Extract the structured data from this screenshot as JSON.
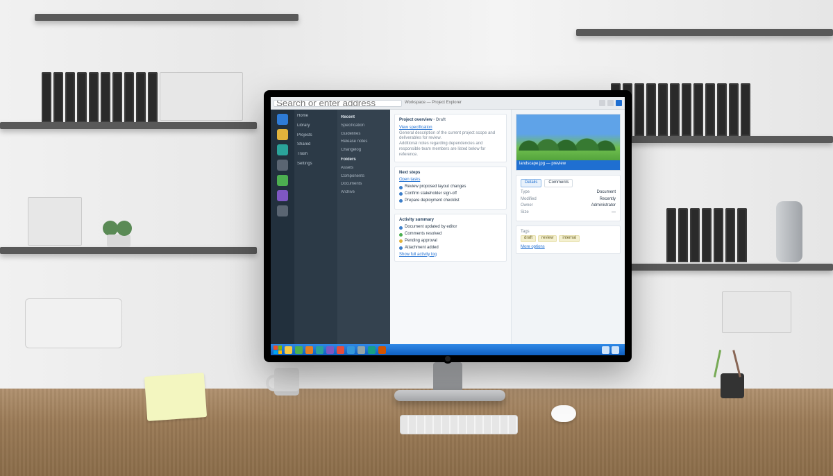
{
  "scene": {
    "description": "Photograph of a modern office desk with a widescreen monitor showing a split-pane desktop application, surrounded by shelves with binders, a plant, a mug, keyboard, mouse, sticky notes and a pencil holder."
  },
  "colors": {
    "accent": "#1f6fd1",
    "sidebar_dark": "#22303d",
    "sidebar_mid": "#2c3a47",
    "taskbar": "#1c72d6"
  },
  "titlebar": {
    "address_placeholder": "Search or enter address",
    "title": "Workspace — Project Explorer"
  },
  "sidebar_icons": [
    {
      "name": "home-icon",
      "color": "c-blue"
    },
    {
      "name": "folder-icon",
      "color": "c-yel"
    },
    {
      "name": "mail-icon",
      "color": "c-teal"
    },
    {
      "name": "clipboard-icon",
      "color": "c-gray"
    },
    {
      "name": "database-icon",
      "color": "c-grn"
    },
    {
      "name": "extensions-icon",
      "color": "c-pur"
    },
    {
      "name": "settings-icon",
      "color": "c-gray"
    }
  ],
  "sidebar_labels": {
    "items": [
      "Home",
      "Library",
      "Projects",
      "Shared",
      "Trash",
      "Settings"
    ]
  },
  "list": {
    "groups": [
      {
        "heading": "Recent",
        "items": [
          "Specification",
          "Guidelines",
          "Release notes",
          "Changelog"
        ]
      },
      {
        "heading": "Folders",
        "items": [
          "Assets",
          "Components",
          "Documents",
          "Archive"
        ]
      }
    ]
  },
  "center": {
    "card1": {
      "heading": "Project overview",
      "sub_label": "Draft",
      "link": "View specification",
      "body": "General description of the current project scope and deliverables for review.",
      "body2": "Additional notes regarding dependencies and responsible team members are listed below for reference."
    },
    "card2": {
      "heading": "Next steps",
      "link": "Open tasks",
      "items": [
        "Review proposed layout changes",
        "Confirm stakeholder sign-off",
        "Prepare deployment checklist"
      ]
    },
    "card3": {
      "heading": "Activity summary",
      "bullets": [
        {
          "cls": "b",
          "text": "Document updated by editor"
        },
        {
          "cls": "g",
          "text": "Comments resolved"
        },
        {
          "cls": "y",
          "text": "Pending approval"
        },
        {
          "cls": "b",
          "text": "Attachment added"
        }
      ],
      "foot_link": "Show full activity log"
    }
  },
  "right": {
    "preview_caption": "landscape.jpg — preview",
    "tabs": {
      "active": "Details",
      "other": "Comments"
    },
    "meta": {
      "rows": [
        {
          "k": "Type",
          "v": "Document"
        },
        {
          "k": "Modified",
          "v": "Recently"
        },
        {
          "k": "Owner",
          "v": "Administrator"
        },
        {
          "k": "Size",
          "v": "—"
        }
      ]
    },
    "tags_label": "Tags",
    "tags": [
      "draft",
      "review",
      "internal"
    ],
    "footer_link": "More options"
  },
  "taskbar": {
    "apps": [
      "explorer",
      "browser",
      "mail",
      "store",
      "editor",
      "terminal",
      "music",
      "photos",
      "calendar",
      "notes"
    ],
    "tray": {
      "net": "network-icon",
      "vol": "volume-icon",
      "clock": "clock"
    }
  }
}
